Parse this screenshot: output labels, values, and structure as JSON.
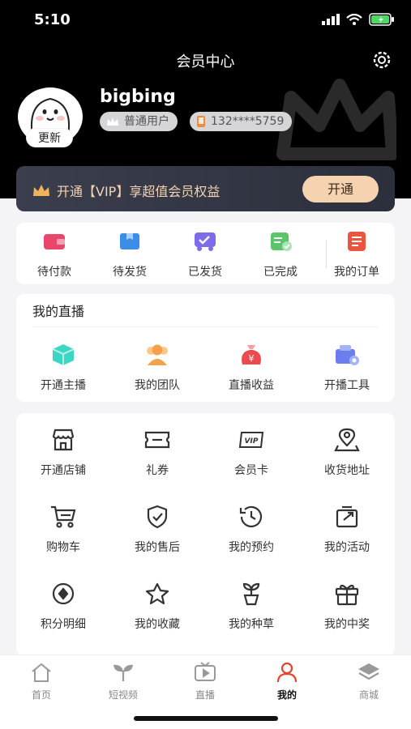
{
  "status_bar": {
    "time": "5:10"
  },
  "header": {
    "title": "会员中心"
  },
  "user": {
    "avatar_badge": "更新",
    "username": "bigbing",
    "level": "普通用户",
    "phone": "132****5759"
  },
  "vip": {
    "text": "开通【VIP】享超值会员权益",
    "button": "开通"
  },
  "orders": [
    "待付款",
    "待发货",
    "已发货",
    "已完成",
    "我的订单"
  ],
  "live": {
    "title": "我的直播",
    "items": [
      "开通主播",
      "我的团队",
      "直播收益",
      "开播工具"
    ]
  },
  "tools": [
    "开通店铺",
    "礼券",
    "会员卡",
    "收货地址",
    "购物车",
    "我的售后",
    "我的预约",
    "我的活动",
    "积分明细",
    "我的收藏",
    "我的种草",
    "我的中奖"
  ],
  "tabs": [
    "首页",
    "短视频",
    "直播",
    "我的",
    "商城"
  ],
  "colors": {
    "header_bg": "#000000",
    "vip_gold": "#f5d3b1",
    "active_tab": "#e0472f"
  }
}
